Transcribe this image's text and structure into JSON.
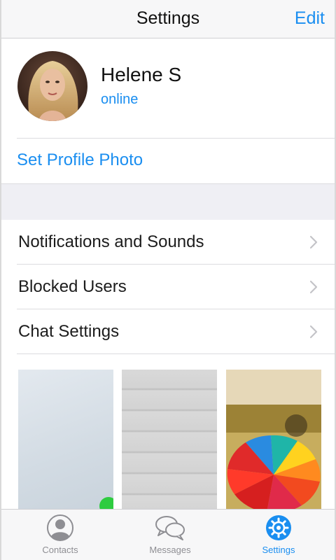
{
  "navbar": {
    "title": "Settings",
    "edit_label": "Edit"
  },
  "profile": {
    "name": "Helene S",
    "status": "online",
    "set_photo_label": "Set Profile Photo"
  },
  "menu": {
    "items": [
      {
        "label": "Notifications and Sounds"
      },
      {
        "label": "Blocked Users"
      },
      {
        "label": "Chat Settings"
      }
    ]
  },
  "wallpapers": {
    "items": [
      "light-blue-texture",
      "grey-wood-planks",
      "rainbow-umbrella"
    ],
    "selected_index": 0
  },
  "tabbar": {
    "tabs": [
      {
        "label": "Contacts",
        "icon": "person-icon"
      },
      {
        "label": "Messages",
        "icon": "chat-bubbles-icon"
      },
      {
        "label": "Settings",
        "icon": "gear-icon"
      }
    ],
    "active": "Settings"
  },
  "colors": {
    "accent": "#1a8ef0",
    "text": "#111111",
    "separator_band": "#efeff4",
    "selected_indicator": "#2ecc40"
  }
}
